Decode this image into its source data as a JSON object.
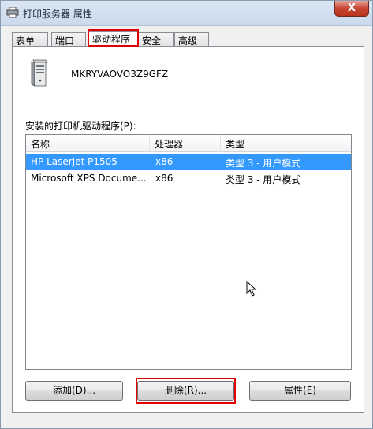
{
  "window": {
    "title": "打印服务器 属性",
    "close_glyph": "X"
  },
  "tabs": [
    {
      "label": "表单",
      "active": false
    },
    {
      "label": "端口",
      "active": false
    },
    {
      "label": "驱动程序",
      "active": true
    },
    {
      "label": "安全",
      "active": false
    },
    {
      "label": "高级",
      "active": false
    }
  ],
  "server": {
    "name": "MKRYVAOVO3Z9GFZ"
  },
  "drivers": {
    "label": "安装的打印机驱动程序(P):",
    "columns": [
      "名称",
      "处理器",
      "类型"
    ],
    "rows": [
      {
        "name": "HP LaserJet P1505",
        "processor": "x86",
        "type": "类型 3 - 用户模式",
        "selected": true
      },
      {
        "name": "Microsoft XPS Docume...",
        "processor": "x86",
        "type": "类型 3 - 用户模式",
        "selected": false
      }
    ]
  },
  "buttons": {
    "add": "添加(D)...",
    "remove": "删除(R)...",
    "properties": "属性(E)"
  },
  "colors": {
    "selection": "#3399ff",
    "highlight_box": "#e00000",
    "close_button": "#c74633"
  },
  "icons": {
    "title": "printer-icon",
    "server": "computer-tower-icon",
    "cursor": "mouse-pointer-icon"
  }
}
